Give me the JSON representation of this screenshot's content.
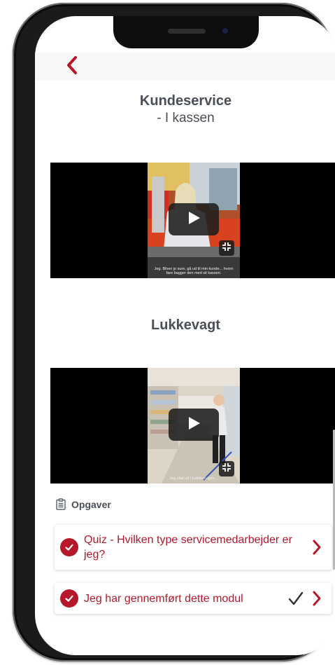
{
  "header": {
    "back_icon": "chevron-left-icon"
  },
  "sections": [
    {
      "title": "Kundeservice",
      "subtitle": "- I kassen",
      "video_caption": "Jeg. Bliver jo sure, gå ud til min kunde... hvorn fare bagger den med sit kasseri."
    },
    {
      "title": "Lukkevagt",
      "video_caption": "Jeg skal ud i butikken igen..."
    }
  ],
  "tasks": {
    "header_label": "Opgaver",
    "header_icon": "clipboard-icon",
    "items": [
      {
        "label": "Quiz - Hvilken type servicemedarbejder er jeg?",
        "completed": true,
        "check_icon": "check-circle-icon"
      },
      {
        "label": "Jeg har gennemført dette modul",
        "completed": true,
        "check_icon": "check-circle-icon",
        "trailing_check": "✓"
      }
    ]
  },
  "colors": {
    "accent": "#b5182a",
    "text": "#4a4f57"
  }
}
